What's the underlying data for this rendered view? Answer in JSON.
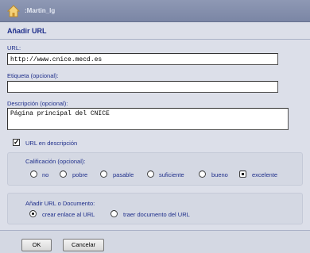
{
  "header": {
    "title": ":Martin_lg",
    "icon": "home-icon"
  },
  "dialog": {
    "heading": "Añadir URL"
  },
  "url": {
    "label": "URL:",
    "value": "http://www.cnice.mecd.es"
  },
  "tag": {
    "label": "Etiqueta (opcional):",
    "value": ""
  },
  "description": {
    "label": "Descripción (opcional):",
    "value": "Página principal del CNICE"
  },
  "url_in_description": {
    "label": "URL en descripción",
    "checked": true
  },
  "rating": {
    "label": "Calificación (opcional):",
    "options": [
      "no",
      "pobre",
      "pasable",
      "suficiente",
      "bueno",
      "excelente"
    ],
    "selected": "excelente"
  },
  "add_mode": {
    "label": "Añadir URL o Documento:",
    "options": [
      "crear enlace al URL",
      "traer documento del URL"
    ],
    "selected": "crear enlace al URL"
  },
  "buttons": {
    "ok": "OK",
    "cancel": "Cancelar"
  },
  "colors": {
    "titlebar": "#7b86a5",
    "label": "#1d2d8a",
    "background": "#dcdfe9"
  }
}
